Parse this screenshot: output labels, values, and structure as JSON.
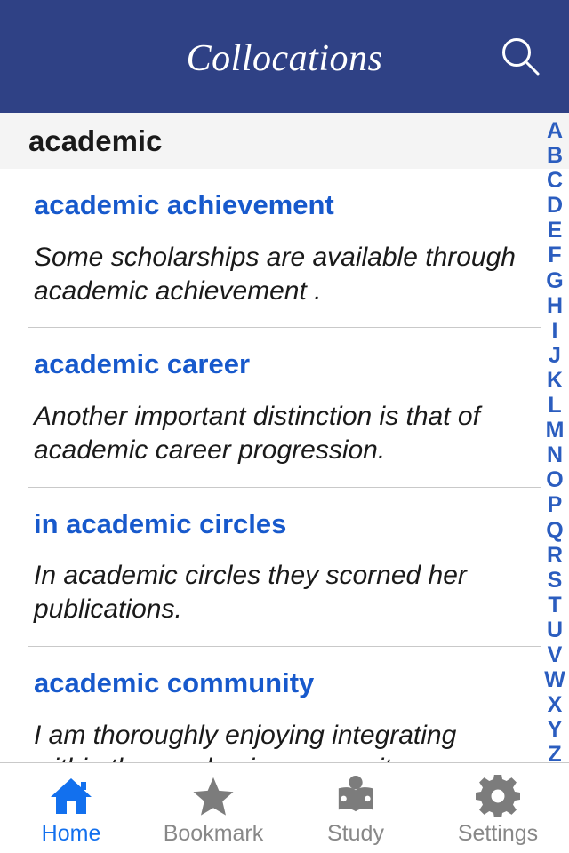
{
  "navbar": {
    "title": "Collocations",
    "search_icon": "search-icon",
    "background_color": "#2F4185",
    "title_color": "#FFFFFF"
  },
  "word_header": {
    "word": "academic",
    "background_color": "#F4F4F4"
  },
  "entries": [
    {
      "term": "academic achievement",
      "example": "Some scholarships are available through academic achievement ."
    },
    {
      "term": "academic career",
      "example": "Another important distinction is that of academic career progression."
    },
    {
      "term": "in academic circles",
      "example": "In academic circles they scorned her publications."
    },
    {
      "term": "academic community",
      "example": "I am thoroughly enjoying integrating within the academic community."
    }
  ],
  "alpha_index": {
    "letters": [
      "A",
      "B",
      "C",
      "D",
      "E",
      "F",
      "G",
      "H",
      "I",
      "J",
      "K",
      "L",
      "M",
      "N",
      "O",
      "P",
      "Q",
      "R",
      "S",
      "T",
      "U",
      "V",
      "W",
      "X",
      "Y",
      "Z"
    ],
    "color": "#2B5DBF"
  },
  "tabbar": {
    "active_color": "#1270EE",
    "inactive_color": "#888888",
    "tabs": [
      {
        "label": "Home",
        "icon": "home-icon",
        "active": true
      },
      {
        "label": "Bookmark",
        "icon": "star-icon",
        "active": false
      },
      {
        "label": "Study",
        "icon": "reading-person-icon",
        "active": false
      },
      {
        "label": "Settings",
        "icon": "gear-icon",
        "active": false
      }
    ]
  },
  "theme": {
    "term_color": "#1759CC",
    "text_color": "#1A1A1A",
    "divider_color": "#C9C9C9"
  }
}
